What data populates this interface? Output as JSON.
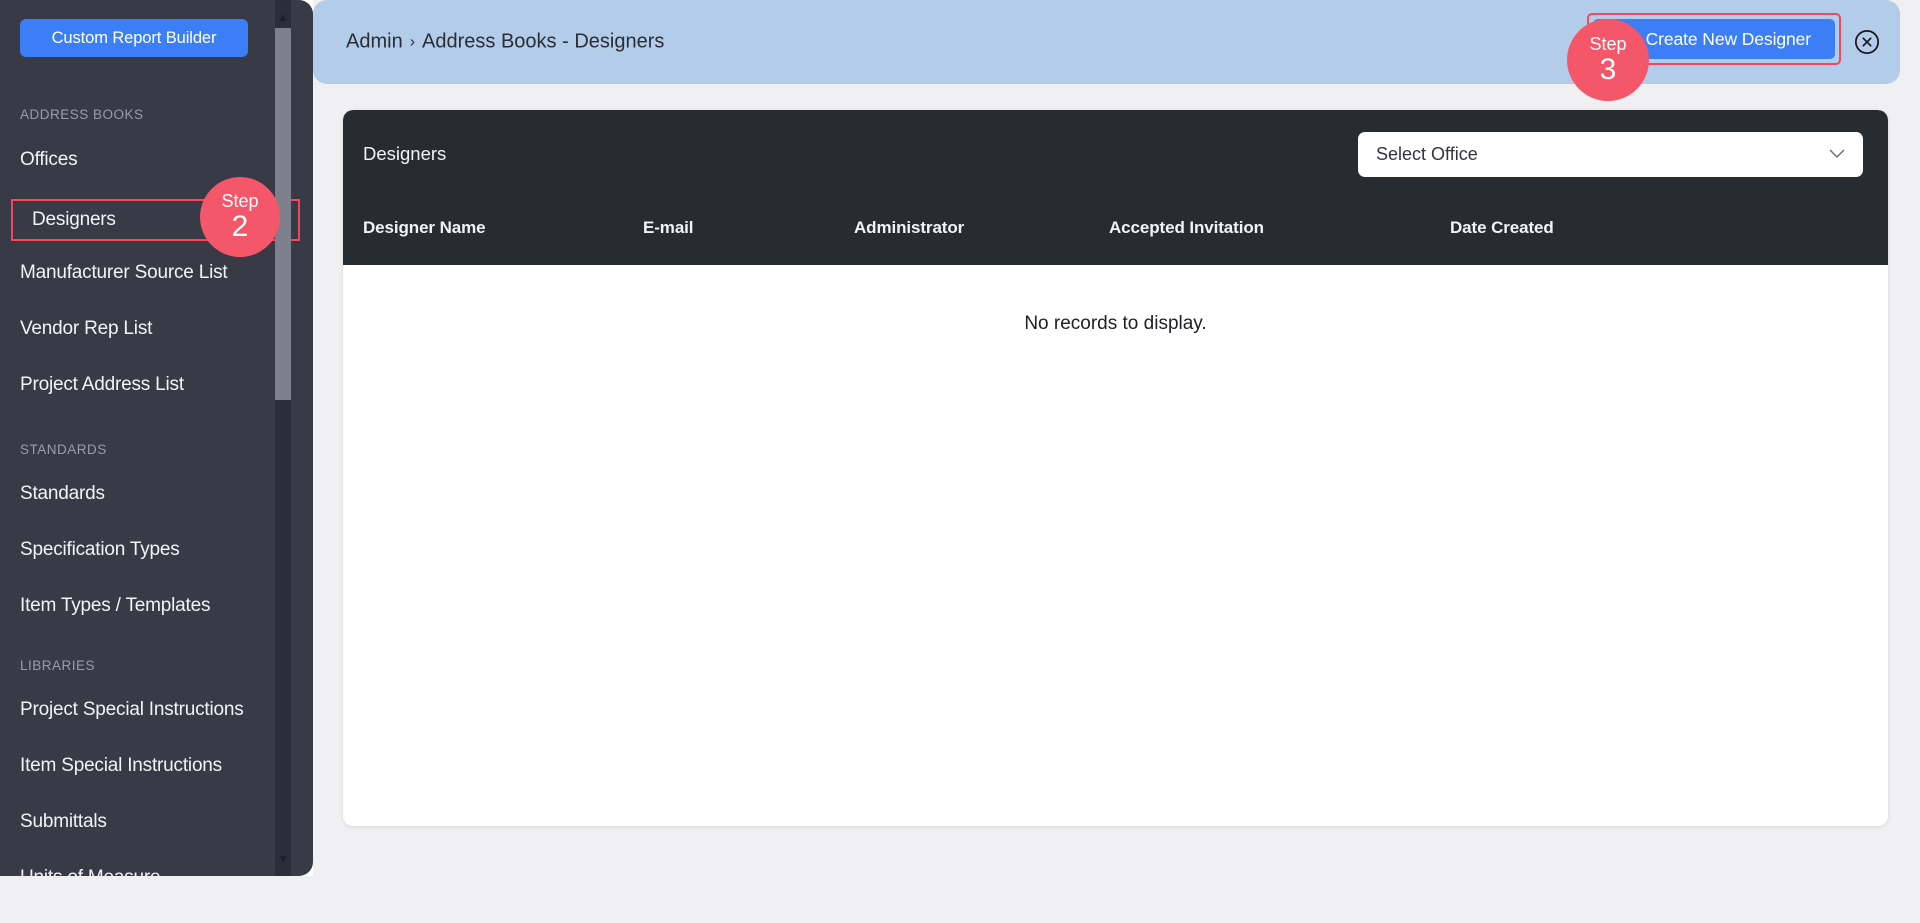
{
  "sidebar": {
    "report_builder_label": "Custom Report Builder",
    "sections": [
      {
        "label": "ADDRESS BOOKS",
        "items": [
          {
            "label": "Offices",
            "highlighted": false
          },
          {
            "label": "Designers",
            "highlighted": true
          },
          {
            "label": "Manufacturer Source List",
            "highlighted": false
          },
          {
            "label": "Vendor Rep List",
            "highlighted": false
          },
          {
            "label": "Project Address List",
            "highlighted": false
          }
        ]
      },
      {
        "label": "STANDARDS",
        "items": [
          {
            "label": "Standards",
            "highlighted": false
          },
          {
            "label": "Specification Types",
            "highlighted": false
          },
          {
            "label": "Item Types / Templates",
            "highlighted": false
          }
        ]
      },
      {
        "label": "LIBRARIES",
        "items": [
          {
            "label": "Project Special Instructions",
            "highlighted": false
          },
          {
            "label": "Item Special Instructions",
            "highlighted": false
          },
          {
            "label": "Submittals",
            "highlighted": false
          },
          {
            "label": "Units of Measure",
            "highlighted": false
          }
        ]
      }
    ]
  },
  "topbar": {
    "breadcrumb_root": "Admin",
    "breadcrumb_separator": "›",
    "breadcrumb_current": "Address Books - Designers",
    "create_button_label": "Create New Designer",
    "create_button_icon": "plus-circle-icon",
    "close_icon": "close-circle-icon"
  },
  "steps": [
    {
      "id": "step2",
      "word": "Step",
      "number": "2"
    },
    {
      "id": "step3",
      "word": "Step",
      "number": "3"
    }
  ],
  "card": {
    "title": "Designers",
    "office_select": {
      "placeholder": "Select Office",
      "chevron_icon": "chevron-down-icon"
    },
    "columns": [
      "Designer Name",
      "E-mail",
      "Administrator",
      "Accepted Invitation",
      "Date Created"
    ],
    "empty_message": "No records to display."
  },
  "colors": {
    "accent_blue": "#3b7ef5",
    "highlight_red": "#f4465c",
    "step_badge": "#f4566a",
    "sidebar_bg": "#383a46",
    "card_header_bg": "#272c30",
    "topbar_bg": "#b3cce9",
    "page_bg": "#f0f0f2"
  }
}
